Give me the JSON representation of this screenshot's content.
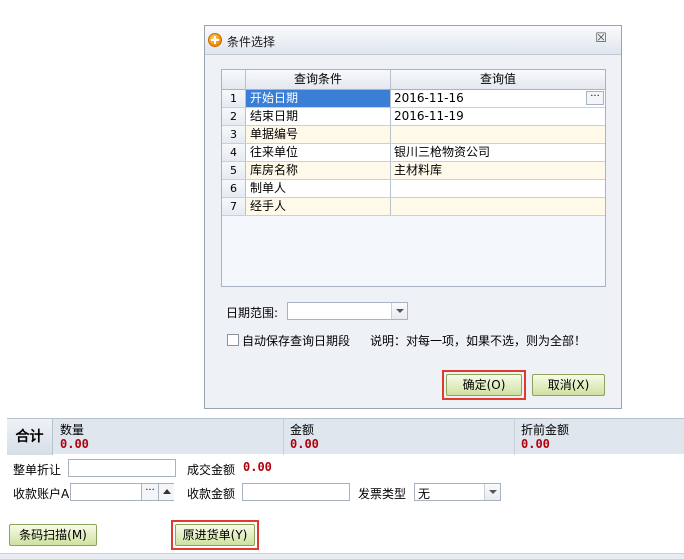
{
  "dialog": {
    "title": "条件选择",
    "grid": {
      "headers": [
        "查询条件",
        "查询值"
      ],
      "rows": [
        {
          "num": "1",
          "name": "开始日期",
          "value": "2016-11-16"
        },
        {
          "num": "2",
          "name": "结束日期",
          "value": "2016-11-19"
        },
        {
          "num": "3",
          "name": "单据编号",
          "value": ""
        },
        {
          "num": "4",
          "name": "往来单位",
          "value": "银川三枪物资公司"
        },
        {
          "num": "5",
          "name": "库房名称",
          "value": "主材料库"
        },
        {
          "num": "6",
          "name": "制单人",
          "value": ""
        },
        {
          "num": "7",
          "name": "经手人",
          "value": ""
        }
      ],
      "ellipsis": "···"
    },
    "date_range_label": "日期范围:",
    "date_range_value": "",
    "autosave_label": "自动保存查询日期段",
    "hint": "说明：对每一项，如果不选，则为全部！",
    "ok_label": "确定(O)",
    "cancel_label": "取消(X)",
    "close_glyph": "☒"
  },
  "totals": {
    "label": "合计",
    "quantity_title": "数量",
    "quantity_value": "0.00",
    "amount_title": "金额",
    "amount_value": "0.00",
    "pre_discount_title": "折前金额",
    "pre_discount_value": "0.00"
  },
  "form": {
    "discount_label": "整单折让",
    "discount_value": "",
    "deal_amount_label": "成交金额",
    "deal_amount_value": "0.00",
    "account_label": "收款账户A",
    "account_value": "",
    "account_ellipsis": "···",
    "received_label": "收款金额",
    "received_value": "",
    "invoice_type_label": "发票类型",
    "invoice_type_value": "无"
  },
  "buttons": {
    "barcode_scan": "条码扫描(M)",
    "original_purchase": "原进货单(Y)"
  },
  "colors": {
    "accent_red": "#e03a2f",
    "selection_blue": "#3a7fd5",
    "value_red": "#b3000c",
    "button_green": "#cfe1a0"
  }
}
